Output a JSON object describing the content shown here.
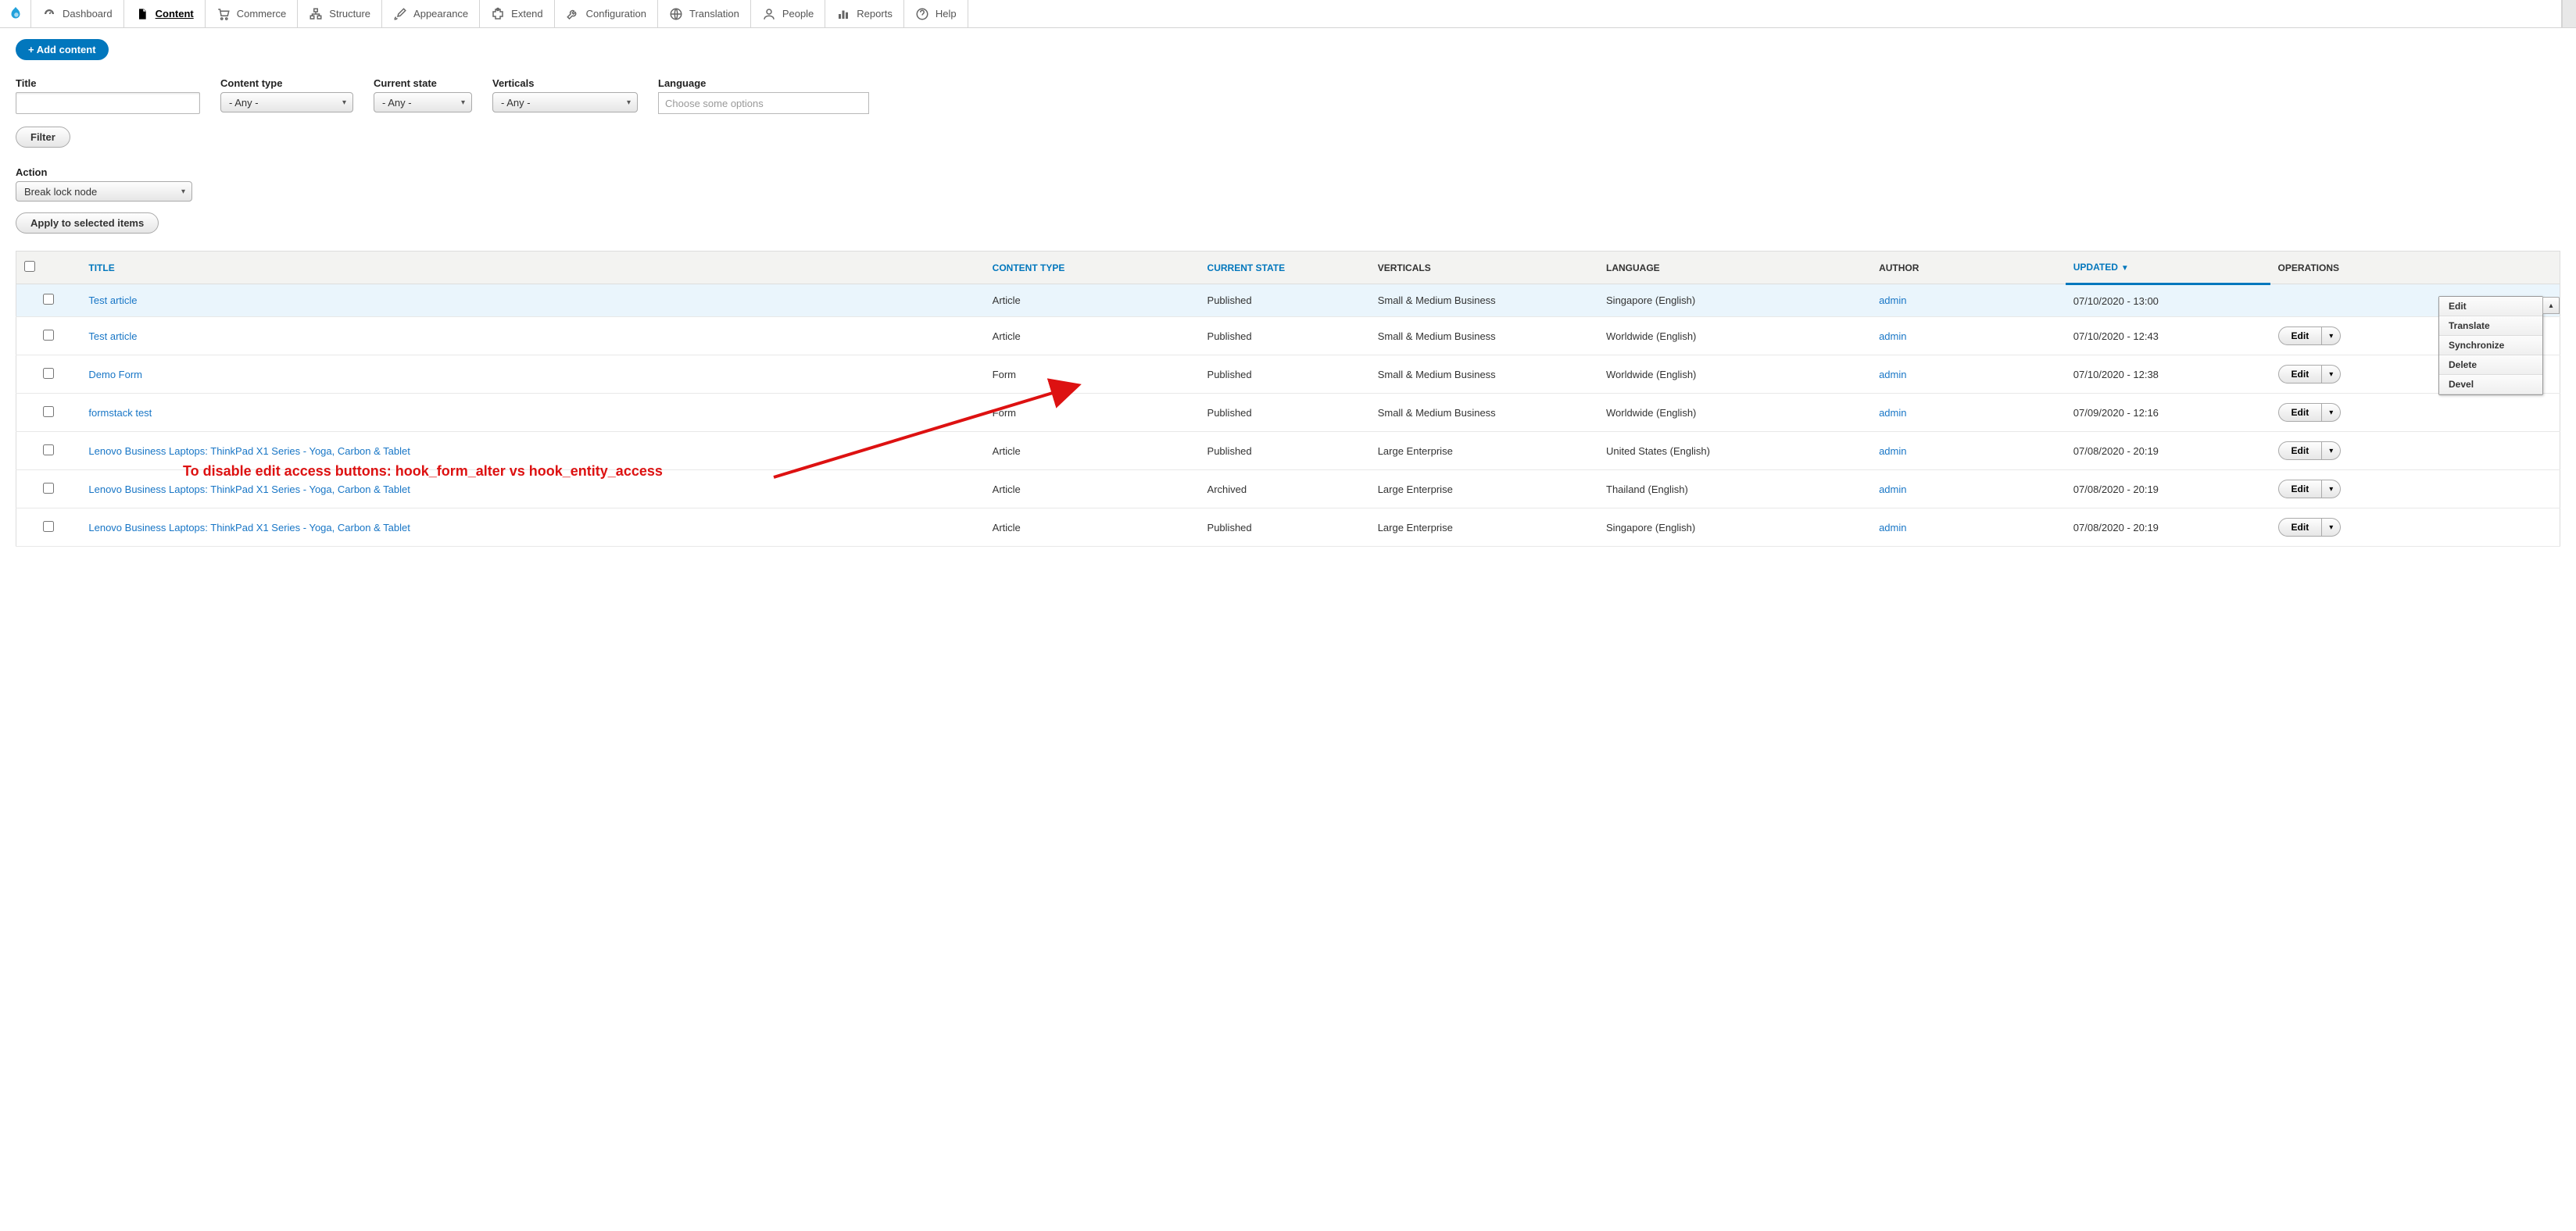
{
  "toolbar": {
    "items": [
      {
        "label": "Dashboard",
        "active": false
      },
      {
        "label": "Content",
        "active": true
      },
      {
        "label": "Commerce",
        "active": false
      },
      {
        "label": "Structure",
        "active": false
      },
      {
        "label": "Appearance",
        "active": false
      },
      {
        "label": "Extend",
        "active": false
      },
      {
        "label": "Configuration",
        "active": false
      },
      {
        "label": "Translation",
        "active": false
      },
      {
        "label": "People",
        "active": false
      },
      {
        "label": "Reports",
        "active": false
      },
      {
        "label": "Help",
        "active": false
      }
    ]
  },
  "buttons": {
    "add_content": "+ Add content",
    "filter": "Filter",
    "apply": "Apply to selected items",
    "edit": "Edit"
  },
  "filters": {
    "title_label": "Title",
    "content_type_label": "Content type",
    "content_type_value": "- Any -",
    "current_state_label": "Current state",
    "current_state_value": "- Any -",
    "verticals_label": "Verticals",
    "verticals_value": "- Any -",
    "language_label": "Language",
    "language_placeholder": "Choose some options"
  },
  "action": {
    "label": "Action",
    "value": "Break lock node"
  },
  "table": {
    "headers": {
      "title": "TITLE",
      "content_type": "CONTENT TYPE",
      "current_state": "CURRENT STATE",
      "verticals": "VERTICALS",
      "language": "LANGUAGE",
      "author": "AUTHOR",
      "updated": "UPDATED",
      "operations": "OPERATIONS"
    },
    "rows": [
      {
        "title": "Test article",
        "ctype": "Article",
        "state": "Published",
        "vert": "Small & Medium Business",
        "lang": "Singapore (English)",
        "author": "admin",
        "updated": "07/10/2020 - 13:00"
      },
      {
        "title": "Test article",
        "ctype": "Article",
        "state": "Published",
        "vert": "Small & Medium Business",
        "lang": "Worldwide (English)",
        "author": "admin",
        "updated": "07/10/2020 - 12:43"
      },
      {
        "title": "Demo Form",
        "ctype": "Form",
        "state": "Published",
        "vert": "Small & Medium Business",
        "lang": "Worldwide (English)",
        "author": "admin",
        "updated": "07/10/2020 - 12:38"
      },
      {
        "title": "formstack test",
        "ctype": "Form",
        "state": "Published",
        "vert": "Small & Medium Business",
        "lang": "Worldwide (English)",
        "author": "admin",
        "updated": "07/09/2020 - 12:16"
      },
      {
        "title": "Lenovo Business Laptops: ThinkPad X1 Series - Yoga, Carbon & Tablet",
        "ctype": "Article",
        "state": "Published",
        "vert": "Large Enterprise",
        "lang": "United States (English)",
        "author": "admin",
        "updated": "07/08/2020 - 20:19"
      },
      {
        "title": "Lenovo Business Laptops: ThinkPad X1 Series - Yoga, Carbon & Tablet",
        "ctype": "Article",
        "state": "Archived",
        "vert": "Large Enterprise",
        "lang": "Thailand (English)",
        "author": "admin",
        "updated": "07/08/2020 - 20:19"
      },
      {
        "title": "Lenovo Business Laptops: ThinkPad X1 Series - Yoga, Carbon & Tablet",
        "ctype": "Article",
        "state": "Published",
        "vert": "Large Enterprise",
        "lang": "Singapore (English)",
        "author": "admin",
        "updated": "07/08/2020 - 20:19"
      }
    ]
  },
  "dropdown": {
    "items": [
      "Edit",
      "Translate",
      "Synchronize",
      "Delete",
      "Devel"
    ]
  },
  "annotation": "To disable edit access buttons: hook_form_alter vs hook_entity_access"
}
